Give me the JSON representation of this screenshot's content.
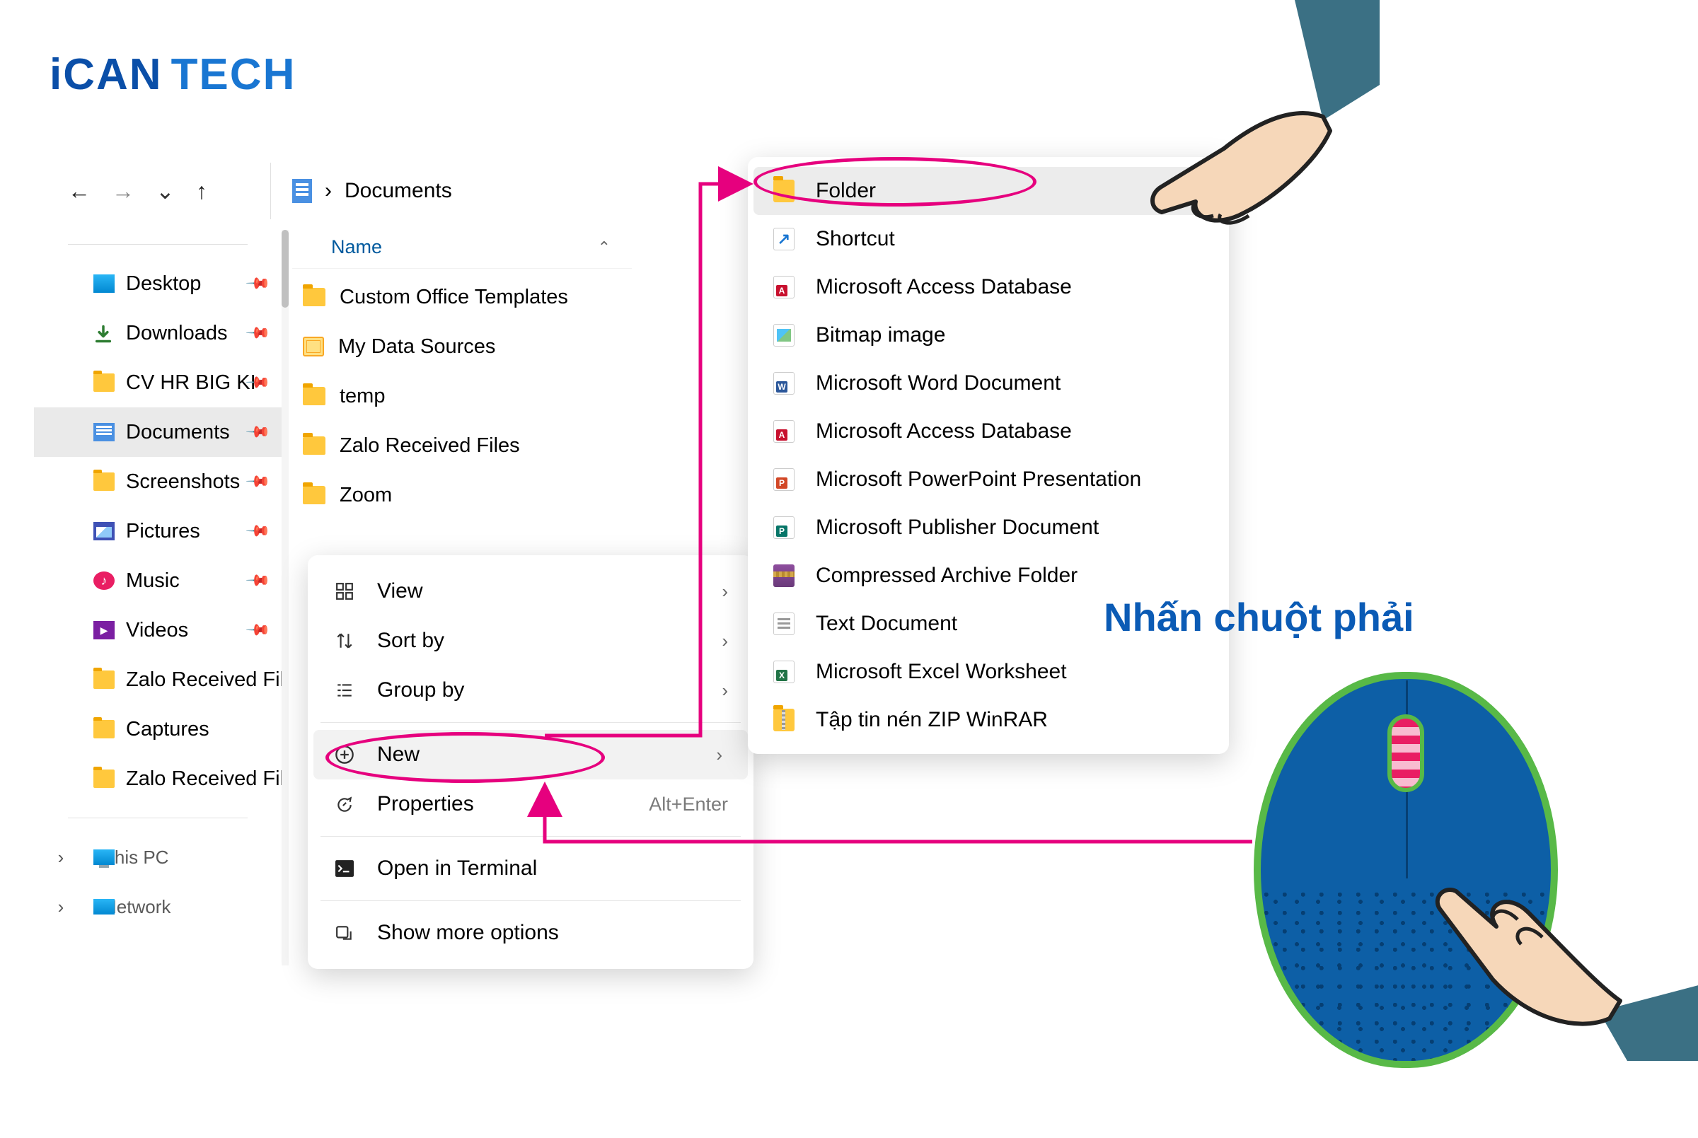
{
  "logo": {
    "brand1": "iCAN",
    "brand2": "TECH"
  },
  "nav": {
    "back": "←",
    "fwd": "→",
    "dd": "⌄",
    "up": "↑"
  },
  "crumb": {
    "sep": "›",
    "loc": "Documents"
  },
  "col": {
    "name": "Name",
    "caret": "⌃"
  },
  "sidebar": {
    "items": [
      {
        "label": "Desktop",
        "icon": "ico-desktop",
        "pinned": true
      },
      {
        "label": "Downloads",
        "icon": "ico-dl",
        "pinned": true,
        "dl": true
      },
      {
        "label": "CV HR BIG KI",
        "icon": "ico-folder",
        "pinned": true
      },
      {
        "label": "Documents",
        "icon": "ico-docs",
        "pinned": true,
        "selected": true
      },
      {
        "label": "Screenshots",
        "icon": "ico-folder",
        "pinned": true
      },
      {
        "label": "Pictures",
        "icon": "ico-pics",
        "pinned": true
      },
      {
        "label": "Music",
        "icon": "ico-music",
        "pinned": true
      },
      {
        "label": "Videos",
        "icon": "ico-video",
        "pinned": true
      },
      {
        "label": "Zalo Received Fil",
        "icon": "ico-folder",
        "pinned": false
      },
      {
        "label": "Captures",
        "icon": "ico-folder",
        "pinned": false
      },
      {
        "label": "Zalo Received Fil",
        "icon": "ico-folder",
        "pinned": false
      }
    ],
    "thispc": "This PC",
    "network": "Network"
  },
  "files": [
    {
      "label": "Custom Office Templates",
      "type": "folder"
    },
    {
      "label": "My Data Sources",
      "type": "special"
    },
    {
      "label": "temp",
      "type": "folder"
    },
    {
      "label": "Zalo Received Files",
      "type": "folder"
    },
    {
      "label": "Zoom",
      "type": "folder"
    }
  ],
  "ctx1": {
    "view": "View",
    "sort": "Sort by",
    "group": "Group by",
    "new": "New",
    "props": "Properties",
    "props_kbd": "Alt+Enter",
    "term": "Open in Terminal",
    "more": "Show more options"
  },
  "ctx2": {
    "items": [
      {
        "label": "Folder",
        "cls": "ft-folder",
        "hl": true
      },
      {
        "label": "Shortcut",
        "cls": "ft-shortcut"
      },
      {
        "label": "Microsoft Access Database",
        "cls": "ft-access"
      },
      {
        "label": "Bitmap image",
        "cls": "ft-bmp"
      },
      {
        "label": "Microsoft Word Document",
        "cls": "ft-word"
      },
      {
        "label": "Microsoft Access Database",
        "cls": "ft-access"
      },
      {
        "label": "Microsoft PowerPoint Presentation",
        "cls": "ft-ppt"
      },
      {
        "label": "Microsoft Publisher Document",
        "cls": "ft-pub"
      },
      {
        "label": "Compressed Archive Folder",
        "cls": "ft-rar"
      },
      {
        "label": "Text Document",
        "cls": "ft-txt"
      },
      {
        "label": "Microsoft Excel Worksheet",
        "cls": "ft-excel"
      },
      {
        "label": "Tập tin nén ZIP WinRAR",
        "cls": "ft-zip"
      }
    ]
  },
  "anno": "Nhấn chuột phải"
}
